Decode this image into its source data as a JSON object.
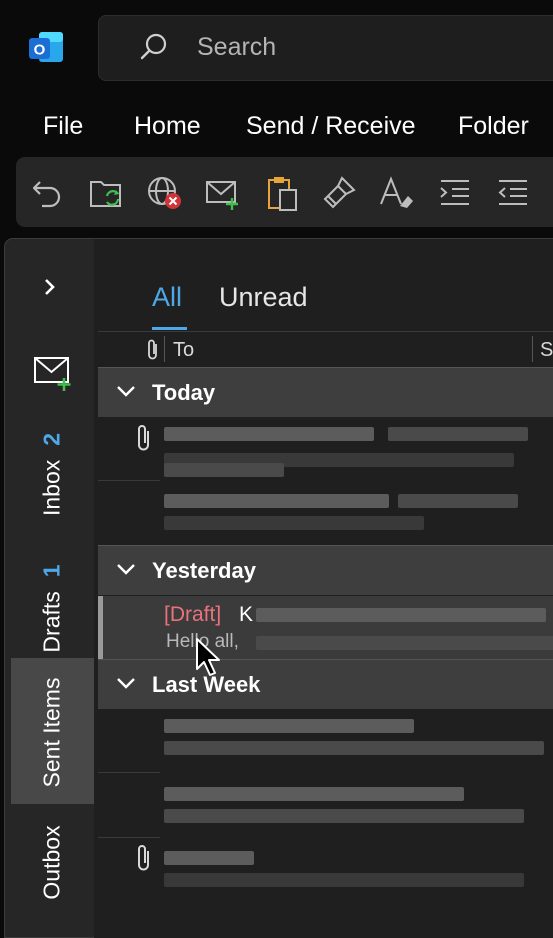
{
  "app": {
    "logo_letter": "O",
    "brand_color": "#1b6fd4"
  },
  "search": {
    "placeholder": "Search"
  },
  "menu": {
    "items": [
      "File",
      "Home",
      "Send / Receive",
      "Folder"
    ]
  },
  "toolbar": {
    "buttons": [
      "undo-icon",
      "sync-folder-icon",
      "work-offline-icon",
      "new-mail-icon",
      "paste-icon",
      "format-painter-icon",
      "clear-formatting-icon",
      "indent-icon",
      "outdent-icon"
    ]
  },
  "sidebar": {
    "expand_icon": "chevron-right-icon",
    "new_mail_icon": "new-mail-icon",
    "folders": [
      {
        "label": "Inbox",
        "count": "2"
      },
      {
        "label": "Drafts",
        "count": "1"
      },
      {
        "label": "Sent Items",
        "count": "",
        "selected": true
      },
      {
        "label": "Outbox",
        "count": ""
      }
    ]
  },
  "list": {
    "tabs": [
      {
        "label": "All",
        "active": true
      },
      {
        "label": "Unread",
        "active": false
      }
    ],
    "columns": {
      "attachment_icon": "paperclip-icon",
      "to": "To",
      "subject": "Su"
    },
    "groups": [
      {
        "title": "Today"
      },
      {
        "title": "Yesterday"
      },
      {
        "title": "Last Week"
      }
    ],
    "draft_item": {
      "tag": "[Draft]",
      "to": "K",
      "preview": "Hello all,"
    }
  },
  "colors": {
    "accent": "#4ea8e8",
    "draft_red": "#e8737d",
    "background": "#0a0a0a"
  }
}
